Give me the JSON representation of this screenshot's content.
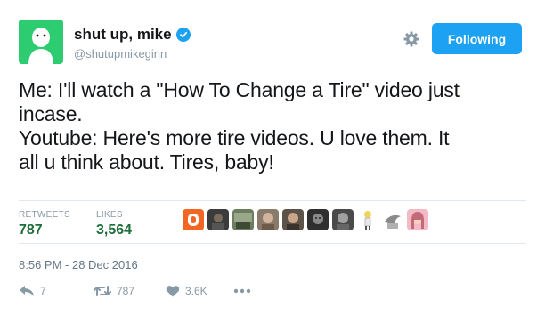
{
  "user": {
    "name": "shut up, mike",
    "handle": "@shutupmikeginn"
  },
  "follow_button": {
    "label": "Following",
    "color": "#1da1f2"
  },
  "tweet": {
    "text": "Me: I'll watch a \"How To Change a Tire\" video just\nincase.\nYoutube: Here's more tire videos. U love them. It\nall u think about. Tires, baby!"
  },
  "stats": {
    "retweets_label": "RETWEETS",
    "retweets_value": "787",
    "likes_label": "LIKES",
    "likes_value": "3,564"
  },
  "likers": [
    "orange-avatar",
    "dark-avatar",
    "scene-avatar",
    "face-avatar",
    "face-avatar-2",
    "dark-avatar-2",
    "dark-avatar-3",
    "cartoon-avatar",
    "bird-avatar",
    "pink-avatar"
  ],
  "timestamp": "8:56 PM - 28 Dec 2016",
  "actions": {
    "reply_count": "7",
    "retweet_count": "787",
    "like_count": "3.6K"
  },
  "colors": {
    "accent": "#1da1f2",
    "stat_value": "#1d6e3a",
    "avatar_bg": "#2ecc71"
  }
}
